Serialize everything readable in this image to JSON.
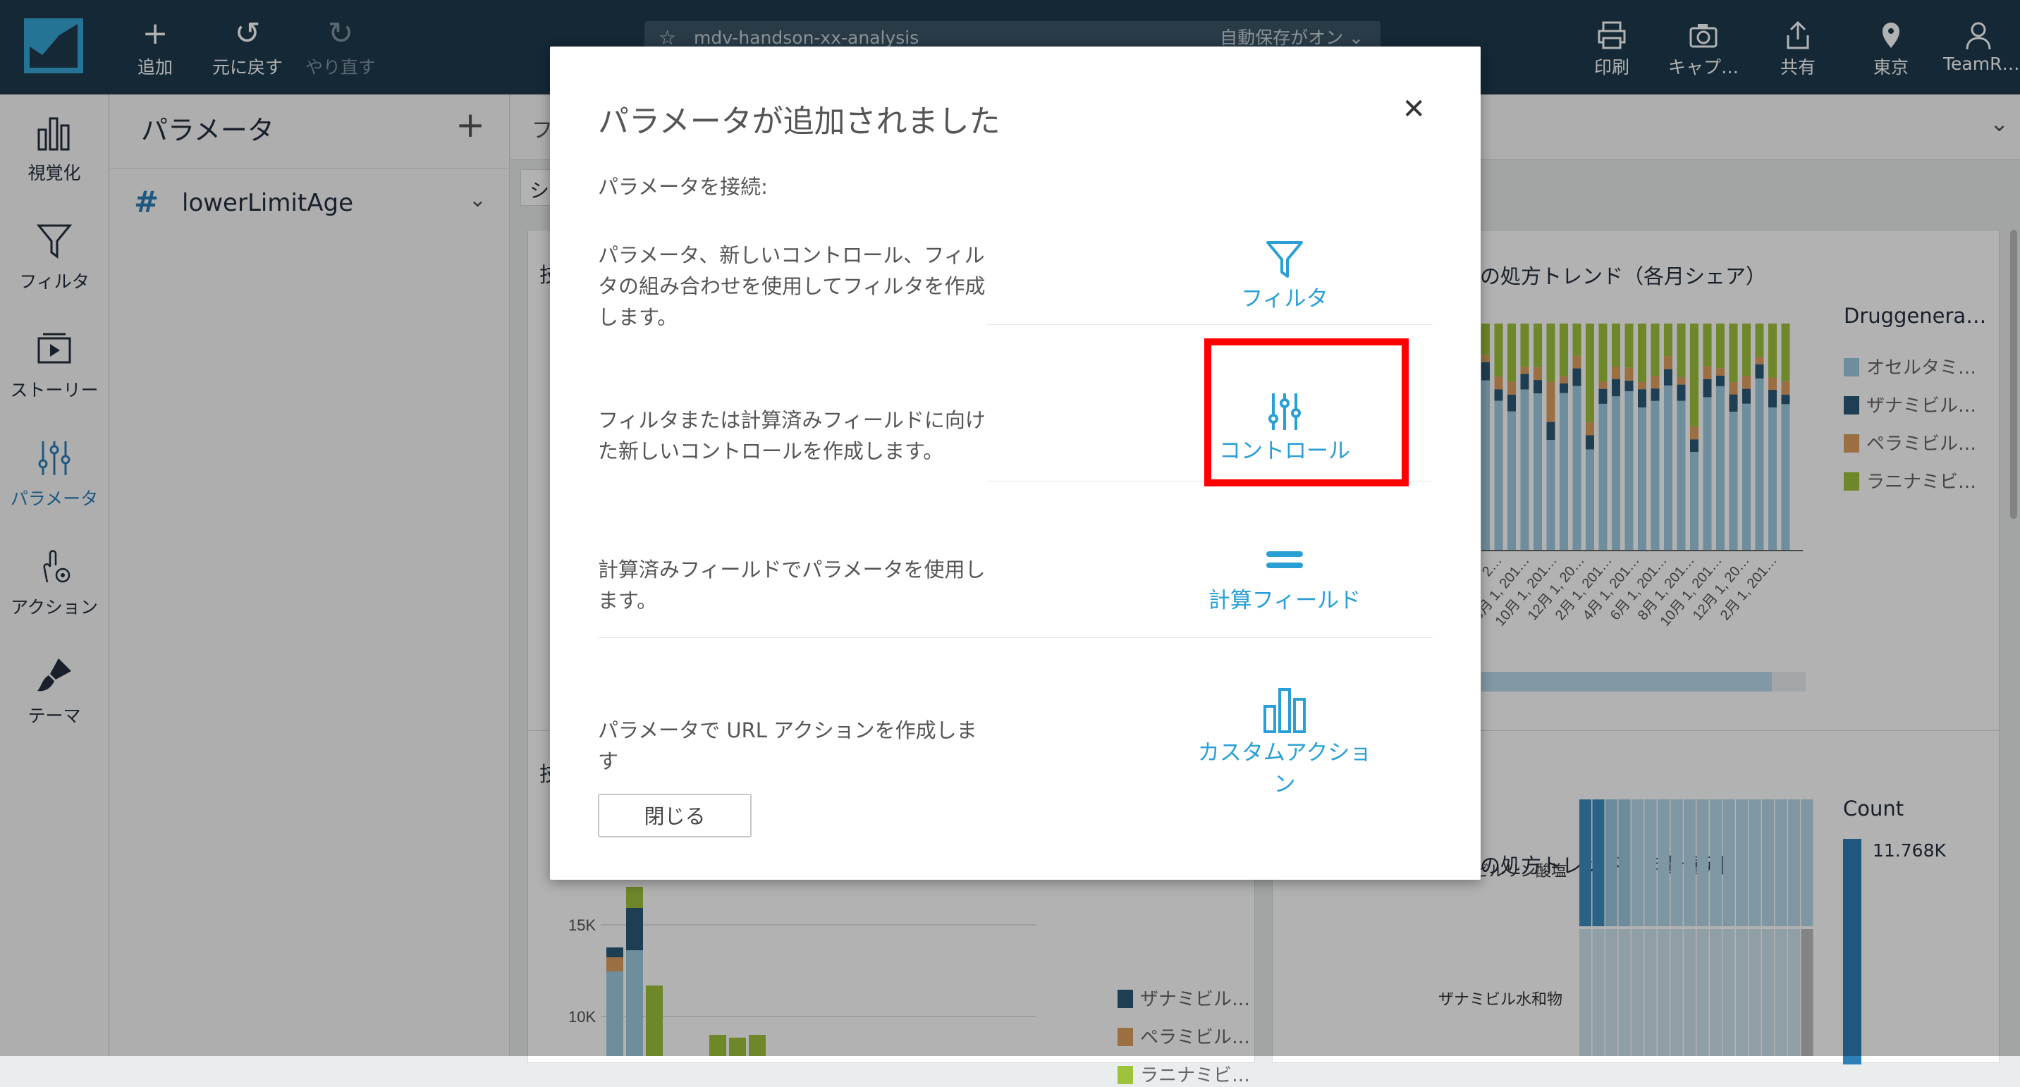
{
  "toolbar": {
    "add": "追加",
    "undo": "元に戻す",
    "redo": "やり直す",
    "analysis_name": "mdv-handson-xx-analysis",
    "autosave": "自動保存がオン",
    "print": "印刷",
    "capture": "キャプ…",
    "share": "共有",
    "region": "東京",
    "account": "TeamR…"
  },
  "rail": {
    "items": [
      {
        "label": "視覚化",
        "icon": "bar-chart-icon"
      },
      {
        "label": "フィルタ",
        "icon": "filter-icon"
      },
      {
        "label": "ストーリー",
        "icon": "story-icon"
      },
      {
        "label": "パラメータ",
        "icon": "sliders-icon",
        "active": true
      },
      {
        "label": "アクション",
        "icon": "action-icon"
      },
      {
        "label": "テーマ",
        "icon": "brush-icon"
      }
    ]
  },
  "panel": {
    "title": "パラメータ",
    "params": [
      {
        "name": "lowerLimitAge"
      }
    ]
  },
  "main": {
    "sheet_tab": "フ",
    "subtab": "シ",
    "visual_top_left_title": "技",
    "visual_bottom_left_title": "技",
    "visual_top_right_title": "の処方トレンド（各月シェア）",
    "visual_bottom_right_title": "の処方トレンド（年齢層別)",
    "legend_top": {
      "title": "Druggenera…",
      "items": [
        {
          "label": "オセルタミ…",
          "color": "#9ecae1"
        },
        {
          "label": "ザナミビル…",
          "color": "#2b5b78"
        },
        {
          "label": "ペラミビル…",
          "color": "#e0a061"
        },
        {
          "label": "ラニナミビ…",
          "color": "#9dc23b"
        }
      ]
    },
    "legend_bottom_left": {
      "items": [
        {
          "label": "ザナミビル…",
          "color": "#2b5b78"
        },
        {
          "label": "ペラミビル…",
          "color": "#e0a061"
        },
        {
          "label": "ラニナミビ…",
          "color": "#9dc23b"
        }
      ]
    },
    "heatmap": {
      "count_label": "Count",
      "count_value": "11.768K",
      "rows": [
        "ビルリン酸塩",
        "ザナミビル水和物"
      ]
    },
    "date_labels": [
      "2…",
      "8月 1, 201…",
      "10月 1, 201…",
      "12月 1, 20…",
      "2月 1, 201…",
      "4月 1, 201…",
      "6月 1, 201…",
      "8月 1, 201…",
      "10月 1, 201…",
      "12月 1, 20…",
      "2月 1, 201…"
    ],
    "y_axis_labels": [
      "15K",
      "10K"
    ]
  },
  "modal": {
    "title": "パラメータが追加されました",
    "subtitle": "パラメータを接続:",
    "options": [
      {
        "desc": "パラメータ、新しいコントロール、フィルタの組み合わせを使用してフィルタを作成します。",
        "label": "フィルタ"
      },
      {
        "desc": "フィルタまたは計算済みフィールドに向けた新しいコントロールを作成します。",
        "label": "コントロール"
      },
      {
        "desc": "計算済みフィールドでパラメータを使用します。",
        "label": "計算フィールド"
      },
      {
        "desc": "パラメータで URL アクションを作成します",
        "label": "カスタムアクション"
      }
    ],
    "close_button": "閉じる"
  },
  "colors": {
    "topbar": "#1e3a4c",
    "accent": "#2a9fd6",
    "highlight": "#ff0000"
  }
}
